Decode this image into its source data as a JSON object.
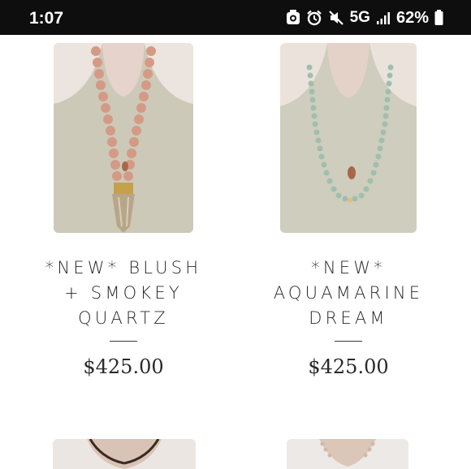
{
  "status_bar": {
    "time": "1:07",
    "network": "5G",
    "battery_percent": "62%",
    "icons": [
      "cast-icon",
      "alarm-icon",
      "mute-icon",
      "signal-icon",
      "battery-icon"
    ]
  },
  "products": [
    {
      "title_lines": [
        "*NEW* BLUSH",
        "+ SMOKEY",
        "QUARTZ"
      ],
      "price": "$425.00"
    },
    {
      "title_lines": [
        "*NEW*",
        "AQUAMARINE",
        "DREAM"
      ],
      "price": "$425.00"
    }
  ],
  "colors": {
    "status_bar_bg": "#0e0e0e",
    "text": "#2a2a2a",
    "blush_beads": "#d49a86",
    "aquamarine_beads": "#9fbfae"
  }
}
